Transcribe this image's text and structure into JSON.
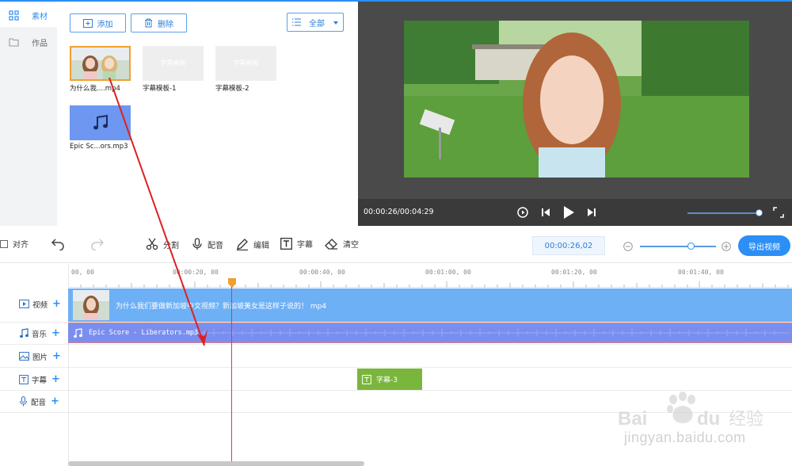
{
  "nav": {
    "items": [
      {
        "label": "素材",
        "icon": "grid-icon"
      },
      {
        "label": "作品",
        "icon": "folder-icon"
      }
    ]
  },
  "media": {
    "add_label": "添加",
    "delete_label": "删除",
    "filter_label": "全部",
    "items": [
      {
        "name": "为什么我....mp4",
        "type": "video"
      },
      {
        "name": "字幕模板-1",
        "type": "subtitle",
        "placeholder_text": "字幕模板"
      },
      {
        "name": "字幕模板-2",
        "type": "subtitle",
        "placeholder_text": "字幕模板"
      },
      {
        "name": "Epic Sc...ors.mp3",
        "type": "audio"
      }
    ]
  },
  "preview": {
    "time": "00:00:26/00:04:29",
    "volume_fraction": 0.9
  },
  "toolbar": {
    "align_label": "对齐",
    "split_label": "分割",
    "dub_label": "配音",
    "edit_label": "编辑",
    "subtitle_label": "字幕",
    "clear_label": "清空",
    "current_time": "00:00:26,02",
    "zoom_fraction": 0.56,
    "export_label": "导出视频"
  },
  "timeline": {
    "ruler_labels": [
      "00, 00",
      "00:00:20, 00",
      "00:00:40, 00",
      "00:01:00, 00",
      "00:01:20, 00",
      "00:01:40, 00"
    ],
    "tracks": [
      {
        "label": "视频",
        "icon": "video-icon"
      },
      {
        "label": "音乐",
        "icon": "music-icon"
      },
      {
        "label": "图片",
        "icon": "image-icon"
      },
      {
        "label": "字幕",
        "icon": "text-icon"
      },
      {
        "label": "配音",
        "icon": "mic-icon"
      }
    ],
    "video_clip_title": "为什么我们要做新加坡中文视频？新加坡美女是这样子说的！ mp4",
    "audio_clip_title": "Epic Score - Liberators.mp3",
    "subtitle_clip_label": "字幕-3"
  },
  "watermark": {
    "text": "jingyan.baidu.com"
  },
  "colors": {
    "accent": "#2b8ff5",
    "video_clip": "#6eb0f5",
    "audio_clip": "#7a8ef0",
    "subtitle_clip": "#7ab63c",
    "playhead": "#e53935"
  }
}
